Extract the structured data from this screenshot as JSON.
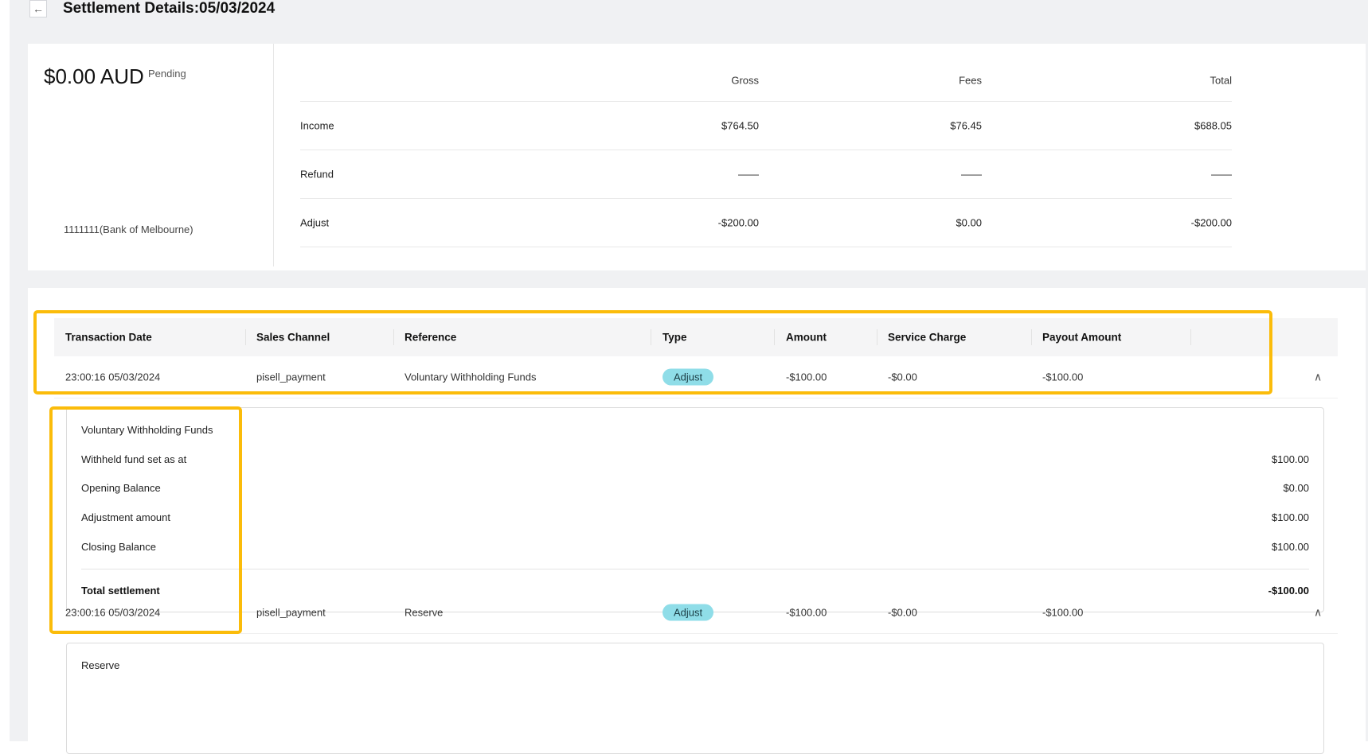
{
  "header": {
    "back_icon": "←",
    "title": "Settlement Details:05/03/2024"
  },
  "summary": {
    "amount": "$0.00 AUD",
    "status": "Pending",
    "bank": "1111111(Bank of Melbourne)",
    "columns": [
      "Gross",
      "Fees",
      "Total"
    ],
    "rows": [
      {
        "label": "Income",
        "gross": "$764.50",
        "fees": "$76.45",
        "total": "$688.05"
      },
      {
        "label": "Refund",
        "gross": "——",
        "fees": "——",
        "total": "——"
      },
      {
        "label": "Adjust",
        "gross": "-$200.00",
        "fees": "$0.00",
        "total": "-$200.00"
      }
    ]
  },
  "transactions": {
    "headers": [
      "Transaction Date",
      "Sales Channel",
      "Reference",
      "Type",
      "Amount",
      "Service Charge",
      "Payout Amount"
    ],
    "rows": [
      {
        "date": "23:00:16 05/03/2024",
        "channel": "pisell_payment",
        "reference": "Voluntary Withholding Funds",
        "type": "Adjust",
        "amount": "-$100.00",
        "service_charge": "-$0.00",
        "payout": "-$100.00",
        "expand_icon": "∧",
        "detail": {
          "title": "Voluntary Withholding Funds",
          "lines": [
            {
              "label": "Withheld fund set as at",
              "value": "$100.00"
            },
            {
              "label": "Opening Balance",
              "value": "$0.00"
            },
            {
              "label": "Adjustment amount",
              "value": "$100.00"
            },
            {
              "label": "Closing Balance",
              "value": "$100.00"
            }
          ],
          "total_label": "Total settlement",
          "total_value": "-$100.00"
        }
      },
      {
        "date": "23:00:16 05/03/2024",
        "channel": "pisell_payment",
        "reference": "Reserve",
        "type": "Adjust",
        "amount": "-$100.00",
        "service_charge": "-$0.00",
        "payout": "-$100.00",
        "expand_icon": "∧",
        "detail": {
          "title": "Reserve"
        }
      }
    ]
  },
  "colors": {
    "highlight": "#fbbc0a",
    "badge": "#8fdde8",
    "page_bg": "#f0f1f3"
  }
}
